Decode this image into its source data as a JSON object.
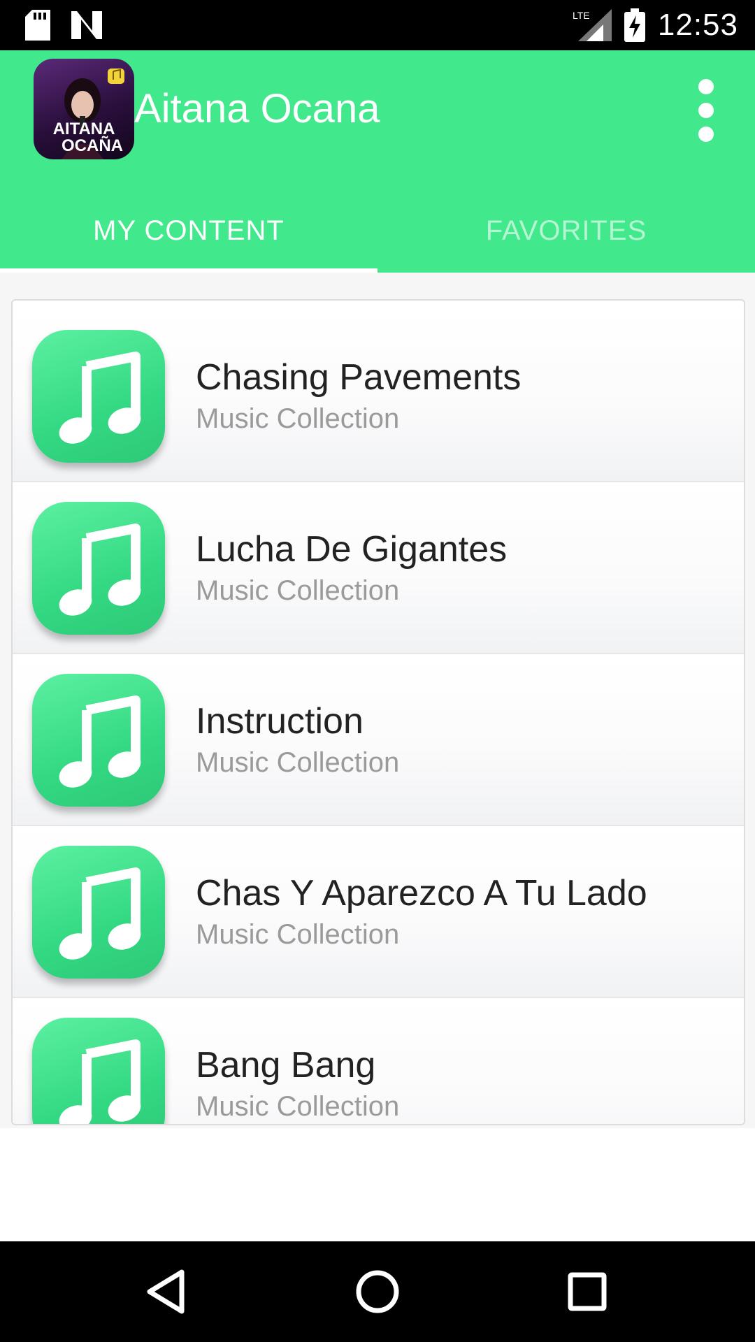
{
  "status_bar": {
    "time": "12:53",
    "network": "LTE",
    "left_icons": [
      "sd-card-icon",
      "n-notification-icon"
    ],
    "right_icons": [
      "lte-signal-icon",
      "battery-charging-icon"
    ]
  },
  "app_bar": {
    "title": "Aitana Ocana",
    "logo_text": [
      "AITANA",
      "OCAÑA"
    ],
    "menu_icon": "more-vert-icon",
    "color": "#41e88c"
  },
  "tabs": [
    {
      "label": "MY CONTENT",
      "selected": true
    },
    {
      "label": "FAVORITES",
      "selected": false
    }
  ],
  "list": {
    "items": [
      {
        "title": "Chasing Pavements",
        "subtitle": "Music Collection",
        "icon": "music-note-icon"
      },
      {
        "title": "Lucha De Gigantes",
        "subtitle": "Music Collection",
        "icon": "music-note-icon"
      },
      {
        "title": "Instruction",
        "subtitle": "Music Collection",
        "icon": "music-note-icon"
      },
      {
        "title": "Chas Y Aparezco A Tu Lado",
        "subtitle": "Music Collection",
        "icon": "music-note-icon"
      },
      {
        "title": "Bang Bang",
        "subtitle": "Music Collection",
        "icon": "music-note-icon"
      }
    ]
  },
  "nav_bar": {
    "buttons": [
      "back-icon",
      "home-icon",
      "recents-icon"
    ]
  }
}
